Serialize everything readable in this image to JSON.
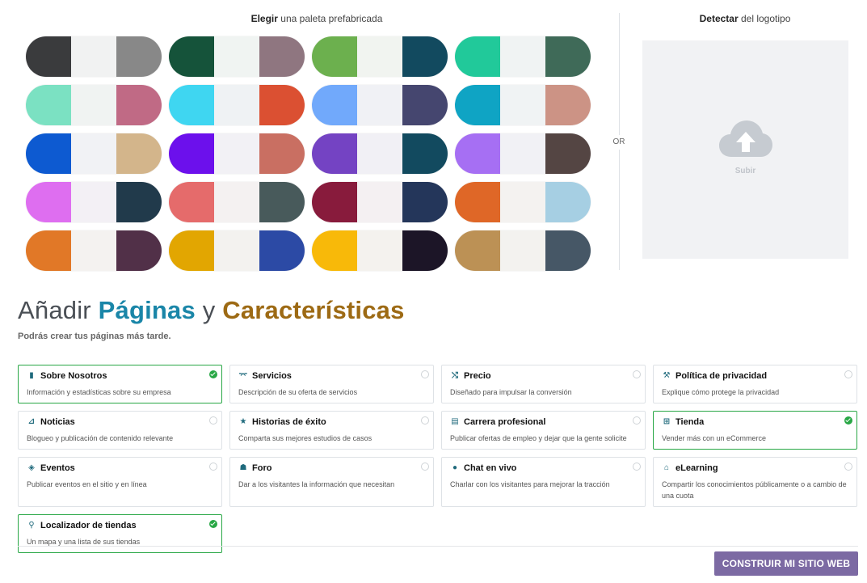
{
  "palette_section": {
    "title_bold": "Elegir",
    "title_rest": " una paleta prefabricada",
    "palettes": [
      [
        "#3a3b3d",
        "#f1f2f2",
        "#888888"
      ],
      [
        "#15533a",
        "#f0f4f2",
        "#8f7680"
      ],
      [
        "#6cb04e",
        "#f1f4f0",
        "#124a5f"
      ],
      [
        "#21c99a",
        "#f0f3f3",
        "#3f6a58"
      ],
      [
        "#7be1c2",
        "#f0f3f2",
        "#c06a85"
      ],
      [
        "#3fd6f1",
        "#eff2f4",
        "#db5032"
      ],
      [
        "#71a9fb",
        "#f0f1f5",
        "#45466f"
      ],
      [
        "#0fa4c4",
        "#f0f3f4",
        "#cc9385"
      ],
      [
        "#0d5ad1",
        "#f1f2f5",
        "#d3b58b"
      ],
      [
        "#6c10ec",
        "#f2f1f5",
        "#c96f62"
      ],
      [
        "#7443c3",
        "#f1f0f5",
        "#124a5f"
      ],
      [
        "#a66ff3",
        "#f1f1f5",
        "#544543"
      ],
      [
        "#de6ef0",
        "#f3f0f5",
        "#213a4b"
      ],
      [
        "#e56b6b",
        "#f4f1f1",
        "#485a5b"
      ],
      [
        "#881b3c",
        "#f4f0f2",
        "#24365a"
      ],
      [
        "#df6727",
        "#f4f2f0",
        "#a6cfe3"
      ],
      [
        "#e17827",
        "#f4f2f0",
        "#513048"
      ],
      [
        "#e2a601",
        "#f3f2ef",
        "#2c4aa5"
      ],
      [
        "#f8b909",
        "#f4f2ee",
        "#1c1527"
      ],
      [
        "#bc9155",
        "#f3f2ef",
        "#465766"
      ]
    ]
  },
  "or_label": "OR",
  "logo_section": {
    "title_bold": "Detectar",
    "title_rest": " del logotipo",
    "upload_label": "Subir",
    "upload_icon": "cloud-upload-icon"
  },
  "features_section": {
    "title_part1": "Añadir ",
    "title_part2": "Páginas",
    "title_part3": " y ",
    "title_part4": "Características",
    "subtitle": "Podrás crear tus páginas más tarde.",
    "items": [
      {
        "title": "Sobre Nosotros",
        "desc": "Información y estadísticas sobre su empresa",
        "icon": "building-icon",
        "glyph": "▮",
        "selected": true
      },
      {
        "title": "Servicios",
        "desc": "Descripción de su oferta de servicios",
        "icon": "handshake-icon",
        "glyph": "⌤",
        "selected": false
      },
      {
        "title": "Precio",
        "desc": "Diseñado para impulsar la conversión",
        "icon": "random-icon",
        "glyph": "⤭",
        "selected": false
      },
      {
        "title": "Política de privacidad",
        "desc": "Explique cómo protege la privacidad",
        "icon": "gavel-icon",
        "glyph": "⚒",
        "selected": false
      },
      {
        "title": "Noticias",
        "desc": "Blogueo y publicación de contenido relevante",
        "icon": "rss-icon",
        "glyph": "⊿",
        "selected": false
      },
      {
        "title": "Historias de éxito",
        "desc": "Comparta sus mejores estudios de casos",
        "icon": "star-icon",
        "glyph": "★",
        "selected": false
      },
      {
        "title": "Carrera profesional",
        "desc": "Publicar ofertas de empleo y dejar que la gente solicite",
        "icon": "id-card-icon",
        "glyph": "▤",
        "selected": false
      },
      {
        "title": "Tienda",
        "desc": "Vender más con un eCommerce",
        "icon": "shopping-cart-icon",
        "glyph": "⊞",
        "selected": true
      },
      {
        "title": "Eventos",
        "desc": "Publicar eventos en el sitio y en línea",
        "icon": "ticket-icon",
        "glyph": "◈",
        "selected": false
      },
      {
        "title": "Foro",
        "desc": "Dar a los visitantes la información que necesitan",
        "icon": "users-icon",
        "glyph": "☗",
        "selected": false
      },
      {
        "title": "Chat en vivo",
        "desc": "Charlar con los visitantes para mejorar la tracción",
        "icon": "comments-icon",
        "glyph": "●",
        "selected": false
      },
      {
        "title": "eLearning",
        "desc": "Compartir los conocimientos públicamente o a cambio de una cuota",
        "icon": "graduation-cap-icon",
        "glyph": "⌂",
        "selected": false
      },
      {
        "title": "Localizador de tiendas",
        "desc": "Un mapa y una lista de sus tiendas",
        "icon": "map-marker-icon",
        "glyph": "⚲",
        "selected": true
      }
    ]
  },
  "build_button_label": "CONSTRUIR MI SITIO WEB",
  "colors": {
    "accent_purple": "#7c6aa3",
    "selected_green": "#28a745",
    "pages_blue": "#1a86a8",
    "features_gold": "#9d6a14"
  }
}
